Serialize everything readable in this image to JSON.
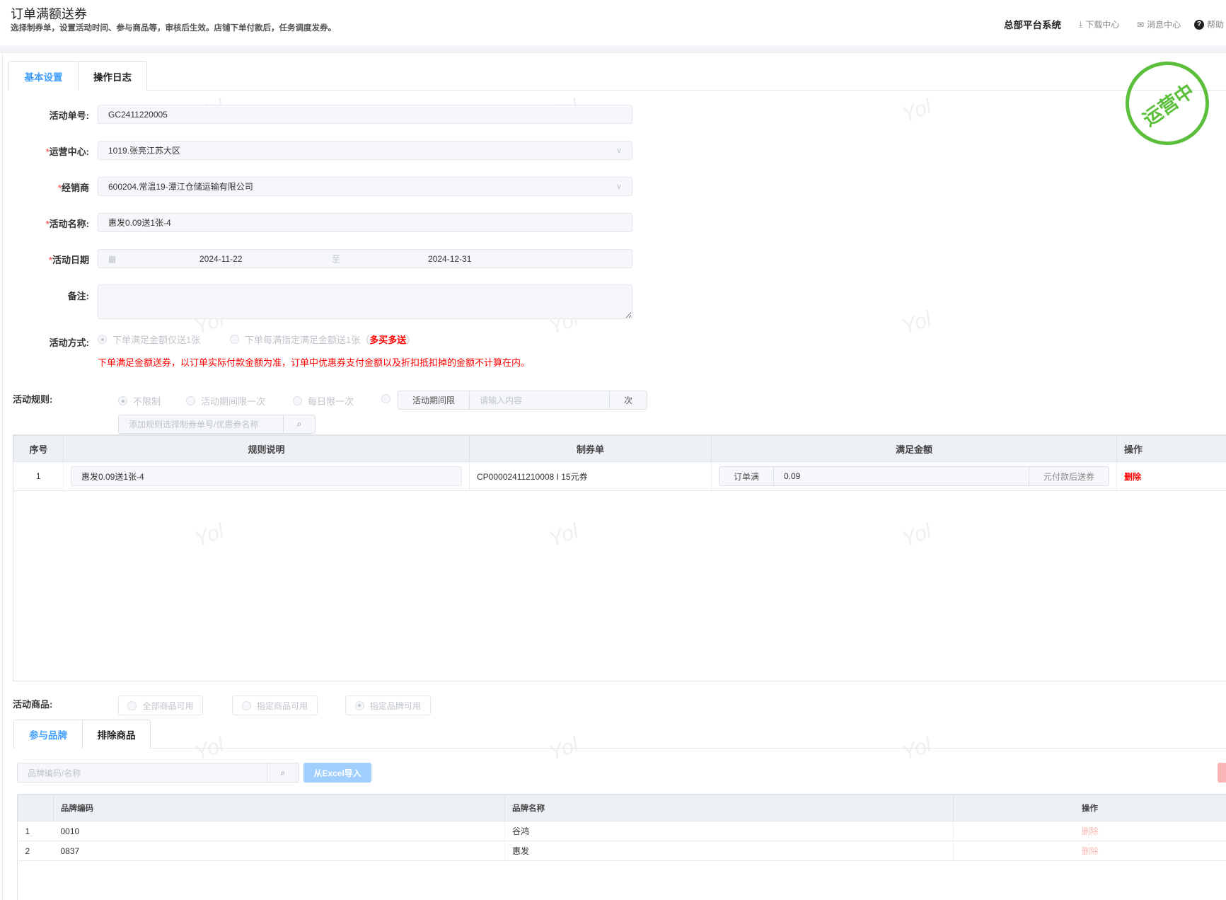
{
  "header": {
    "title": "订单满额送券",
    "subtitle": "选择制券单，设置活动时间、参与商品等，审核后生效。店铺下单付款后，任务调度发券。",
    "system": "总部平台系统",
    "download": "下载中心",
    "messages": "消息中心",
    "help": "帮助"
  },
  "tabs": [
    "基本设置",
    "操作日志"
  ],
  "stamp": "运营中",
  "watermark": "Yol",
  "form": {
    "order_no": {
      "label": "活动单号:",
      "value": "GC2411220005"
    },
    "center": {
      "label": "运营中心:",
      "value": "1019.张亮江苏大区"
    },
    "dealer": {
      "label": "经销商",
      "value": "600204.常温19-潭江仓储运输有限公司"
    },
    "name": {
      "label": "活动名称:",
      "value": "惠发0.09送1张-4"
    },
    "date": {
      "label": "活动日期",
      "start": "2024-11-22",
      "sep": "至",
      "end": "2024-12-31"
    },
    "remark": {
      "label": "备注:",
      "value": ""
    },
    "mode": {
      "label": "活动方式:",
      "opt1": "下单满足金额仅送1张",
      "opt2": "下单每满指定满足金额送1张（",
      "opt2_red": "多买多送",
      "opt2_end": "）",
      "note": "下单满足金额送券，以订单实际付款金额为准，订单中优惠券支付金额以及折扣抵扣掉的金额不计算在内。"
    },
    "rules": {
      "label": "活动规则:",
      "opts": [
        "不限制",
        "活动期间限一次",
        "每日限一次"
      ],
      "limit_prefix": "活动期间限",
      "limit_placeholder": "请输入内容",
      "limit_suffix": "次",
      "search_placeholder": "添加规则选择制券单号/优惠券名称"
    }
  },
  "rules_table": {
    "headers": [
      "序号",
      "规则说明",
      "制券单",
      "满足金额",
      "操作"
    ],
    "rows": [
      {
        "no": "1",
        "desc": "惠发0.09送1张-4",
        "voucher": "CP00002411210008 I 15元券",
        "prefix": "订单满",
        "amount": "0.09",
        "suffix": "元付款后送券",
        "action": "删除"
      }
    ]
  },
  "goods": {
    "label": "活动商品:",
    "opts": [
      "全部商品可用",
      "指定商品可用",
      "指定品牌可用"
    ],
    "tabs": [
      "参与品牌",
      "排除商品"
    ],
    "search_placeholder": "品牌编码/名称",
    "import": "从Excel导入"
  },
  "brand_table": {
    "headers": [
      "",
      "品牌编码",
      "品牌名称",
      "操作"
    ],
    "rows": [
      {
        "no": "1",
        "code": "0010",
        "name": "谷鸿",
        "action": "删除"
      },
      {
        "no": "2",
        "code": "0837",
        "name": "惠发",
        "action": "删除"
      }
    ]
  }
}
